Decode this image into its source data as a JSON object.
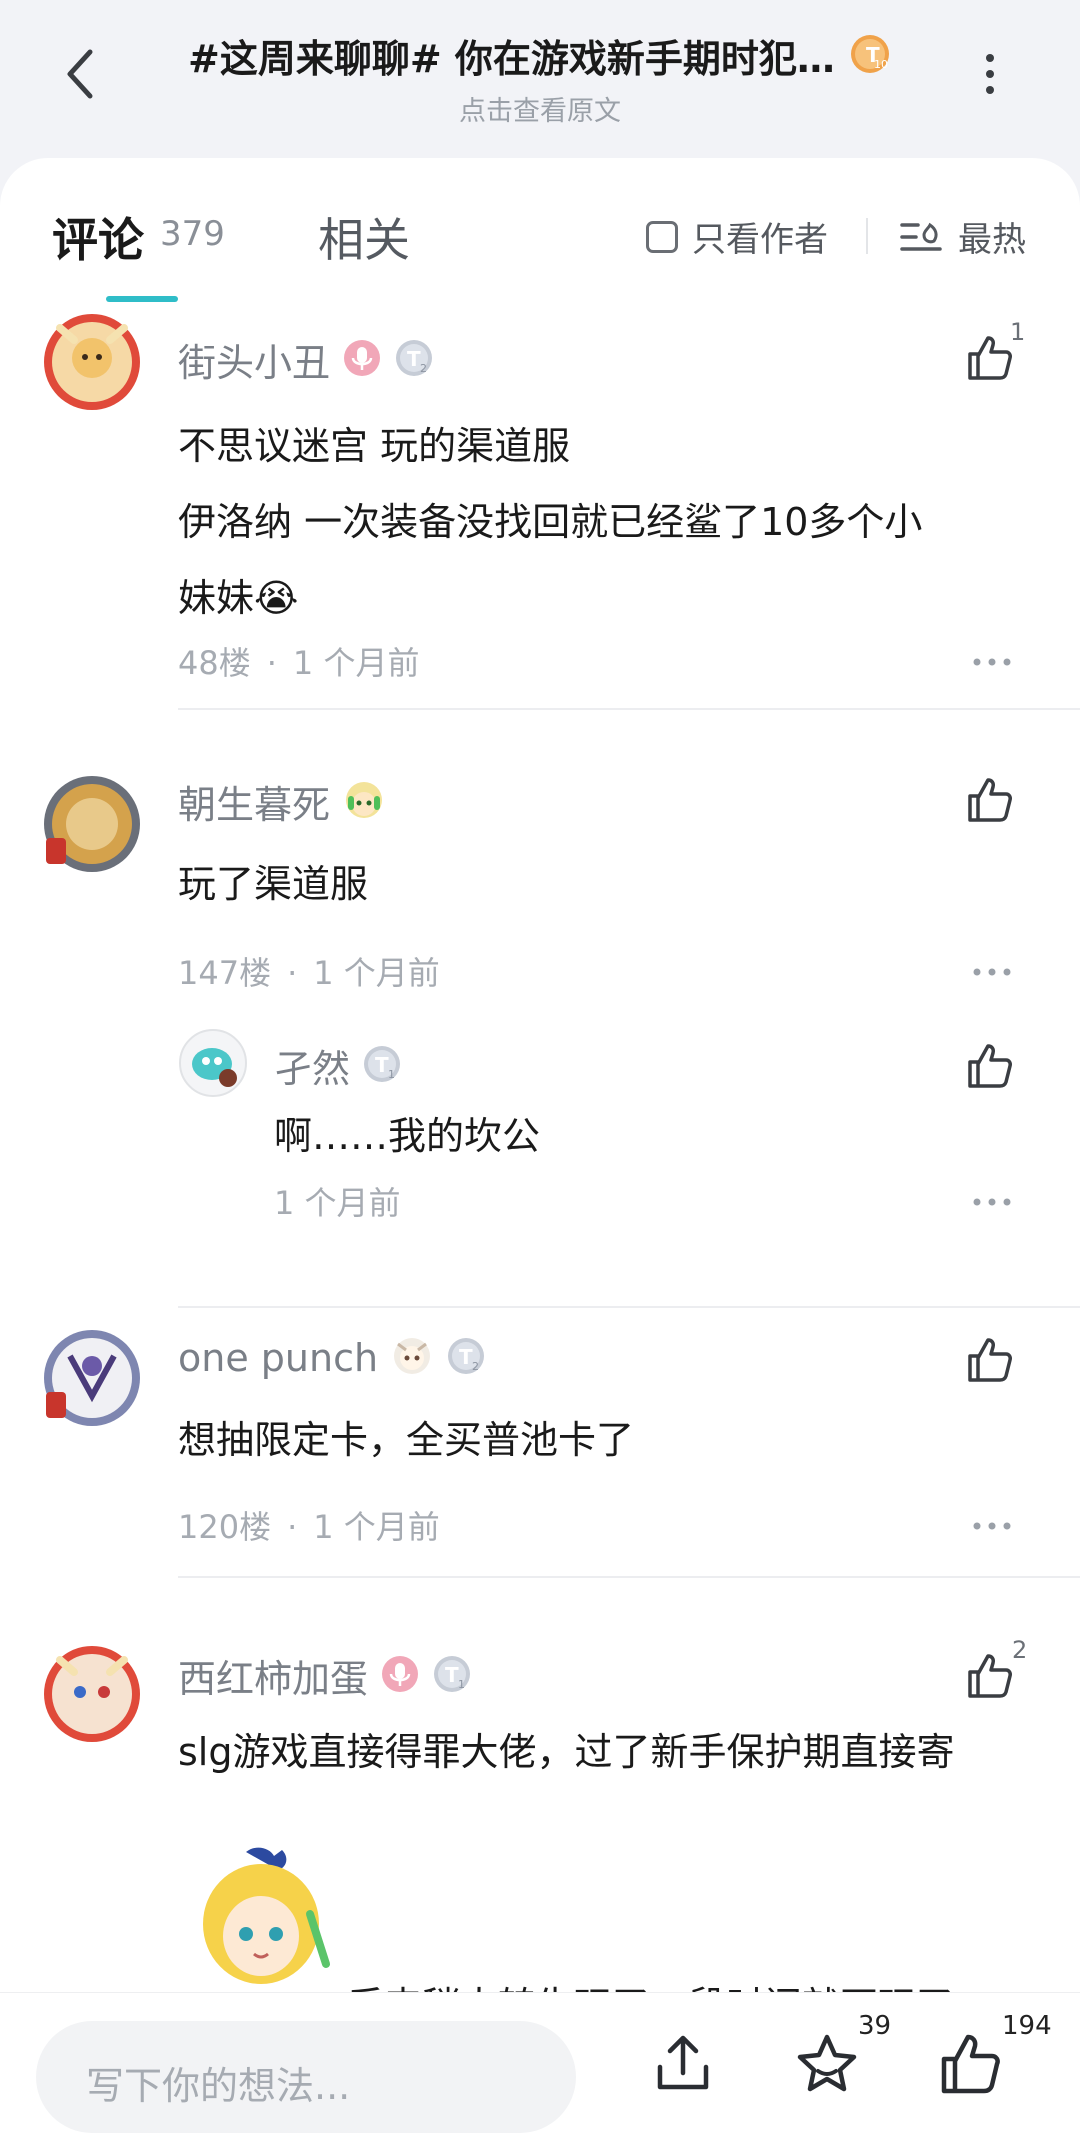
{
  "header": {
    "title": "#这周来聊聊# 你在游戏新手期时犯…",
    "title_badge_level": "10",
    "subtitle": "点击查看原文"
  },
  "tabs": {
    "comment_label": "评论",
    "comment_count": "379",
    "related_label": "相关",
    "only_author_label": "只看作者",
    "sort_label": "最热"
  },
  "comments": [
    {
      "username": "街头小丑",
      "badge_level": "2",
      "like_count": "1",
      "lines": [
        "不思议迷宫 玩的渠道服",
        "伊洛纳 一次装备没找回就已经鲨了10多个小",
        "妹妹😭"
      ],
      "floor": "48楼",
      "time": "1 个月前"
    },
    {
      "username": "朝生暮死",
      "lines": [
        "玩了渠道服"
      ],
      "floor": "147楼",
      "time": "1 个月前",
      "reply": {
        "username": "孑然",
        "badge_level": "1",
        "text": "啊……我的坎公",
        "time": "1 个月前"
      }
    },
    {
      "username": "one punch",
      "badge_level": "2",
      "lines": [
        "想抽限定卡，全买普池卡了"
      ],
      "floor": "120楼",
      "time": "1 个月前"
    },
    {
      "username": "西红柿加蛋",
      "badge_level": "1",
      "like_count": "2",
      "lines": [
        "slg游戏直接得罪大佬，过了新手保护期直接寄",
        "后来稍大转生玩了一段时间就不玩了"
      ]
    }
  ],
  "bottom_bar": {
    "input_placeholder": "写下你的想法...",
    "star_count": "39",
    "like_count": "194"
  },
  "colors": {
    "accent": "#2fbdc8",
    "text_primary": "#1a1a1a",
    "text_secondary": "#7a7f87"
  }
}
